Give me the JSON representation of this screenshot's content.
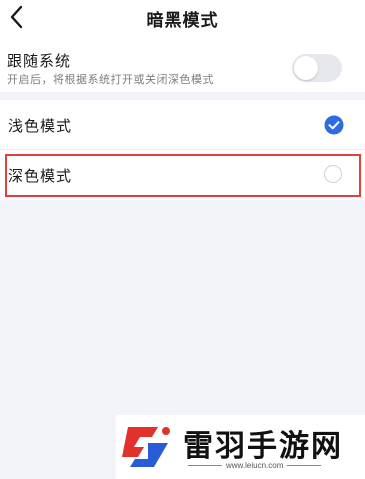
{
  "header": {
    "back_icon": "chevron-left-icon",
    "title": "暗黑模式"
  },
  "follow_system": {
    "title": "跟随系统",
    "description": "开启后，将根据系统打开或关闭深色模式",
    "enabled": false
  },
  "options": [
    {
      "label": "浅色模式",
      "selected": true
    },
    {
      "label": "深色模式",
      "selected": false
    }
  ],
  "colors": {
    "accent": "#2f6be0",
    "highlight_border": "#e0413f",
    "background": "#f2f4f9"
  },
  "watermark": {
    "name": "雷羽手游网",
    "url": "www.leiucn.com"
  }
}
